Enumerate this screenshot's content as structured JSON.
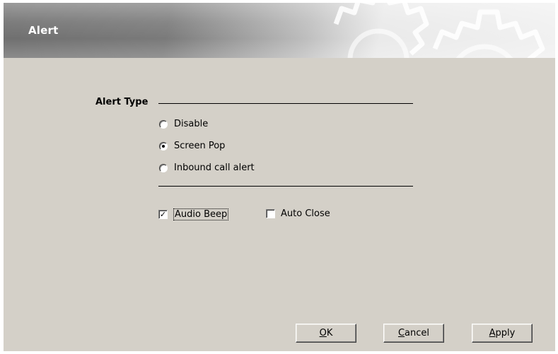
{
  "banner": {
    "title": "Alert"
  },
  "alert_type": {
    "label": "Alert Type",
    "options": [
      {
        "label": "Disable",
        "selected": false
      },
      {
        "label": "Screen Pop",
        "selected": true
      },
      {
        "label": "Inbound call alert",
        "selected": false
      }
    ]
  },
  "options": {
    "audio_beep": {
      "label": "Audio Beep",
      "checked": true
    },
    "auto_close": {
      "label": "Auto Close",
      "checked": false
    }
  },
  "buttons": {
    "ok": {
      "mnemonic": "O",
      "rest": "K"
    },
    "cancel": {
      "mnemonic": "C",
      "rest": "ancel"
    },
    "apply": {
      "mnemonic": "A",
      "rest": "pply"
    }
  },
  "colors": {
    "dialog_bg": "#d4d0c8",
    "banner_title": "#ffffff"
  }
}
